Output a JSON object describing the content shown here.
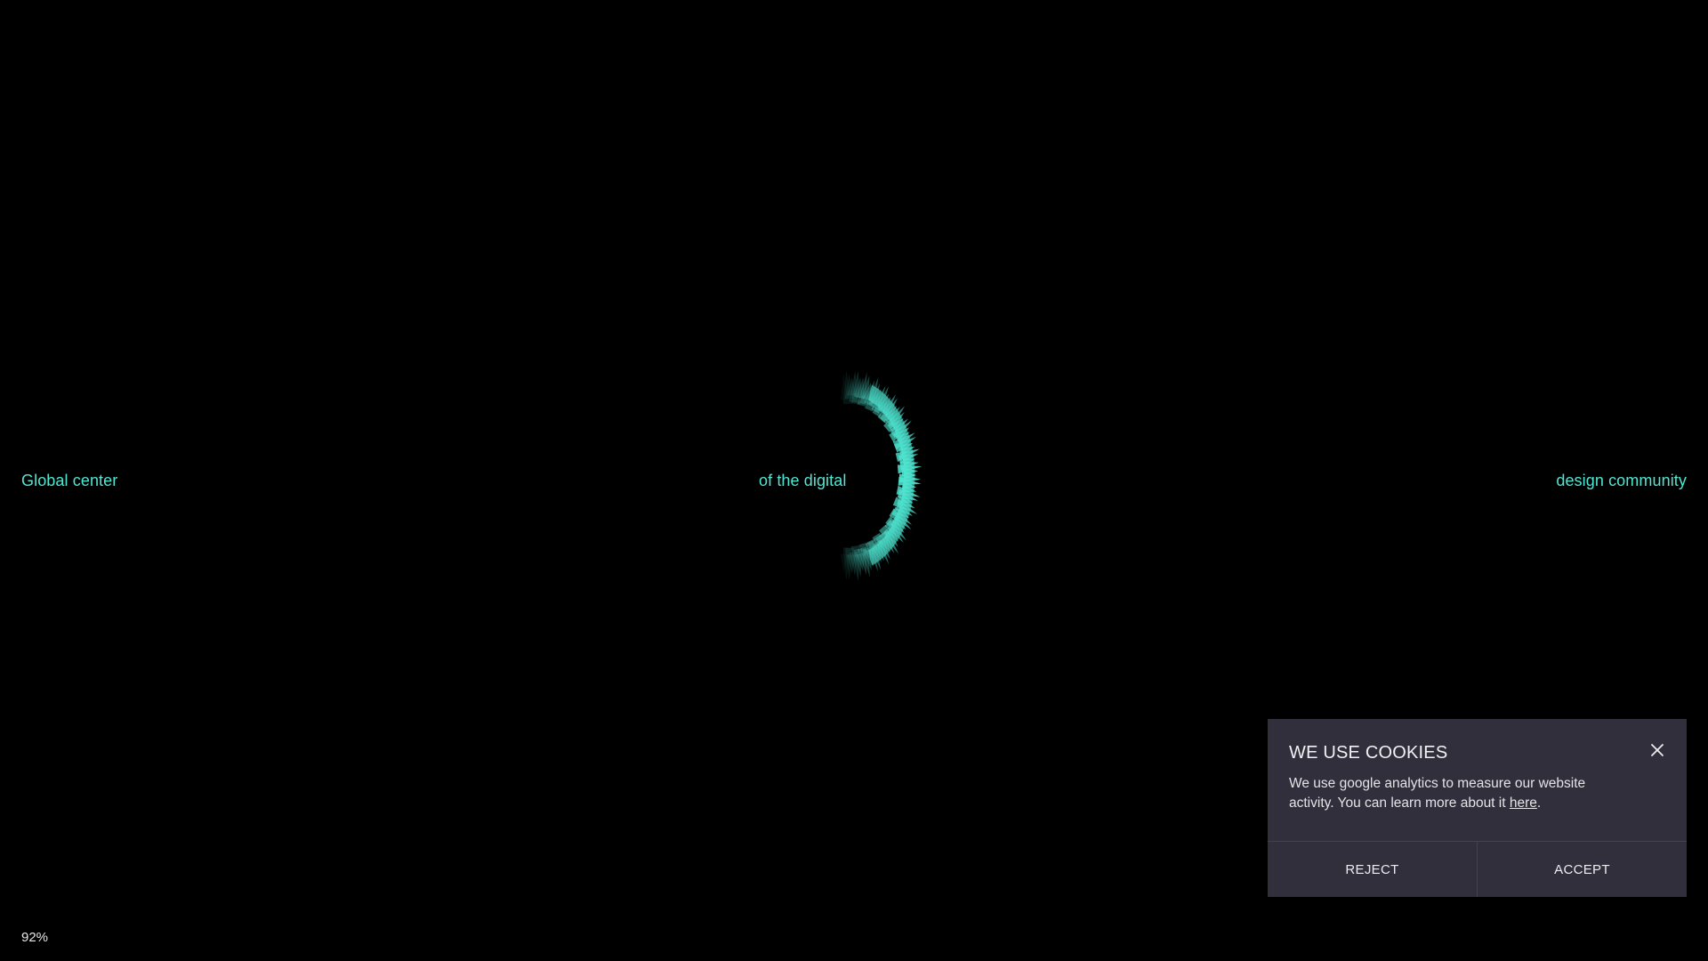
{
  "hero": {
    "text_left": "Global center",
    "text_center": "of the digital",
    "text_right": "design community"
  },
  "loader": {
    "progress_label": "92%",
    "progress": 0.92,
    "accent_color": "#4fe6d2"
  },
  "cookie_banner": {
    "title": "WE USE COOKIES",
    "text_before_link": "We use google analytics to measure our website activity. You can learn more about it ",
    "link_label": "here",
    "text_after_link": ".",
    "close_icon": "close-icon",
    "reject_label": "REJECT",
    "accept_label": "ACCEPT",
    "background_color": "#312f3b"
  }
}
